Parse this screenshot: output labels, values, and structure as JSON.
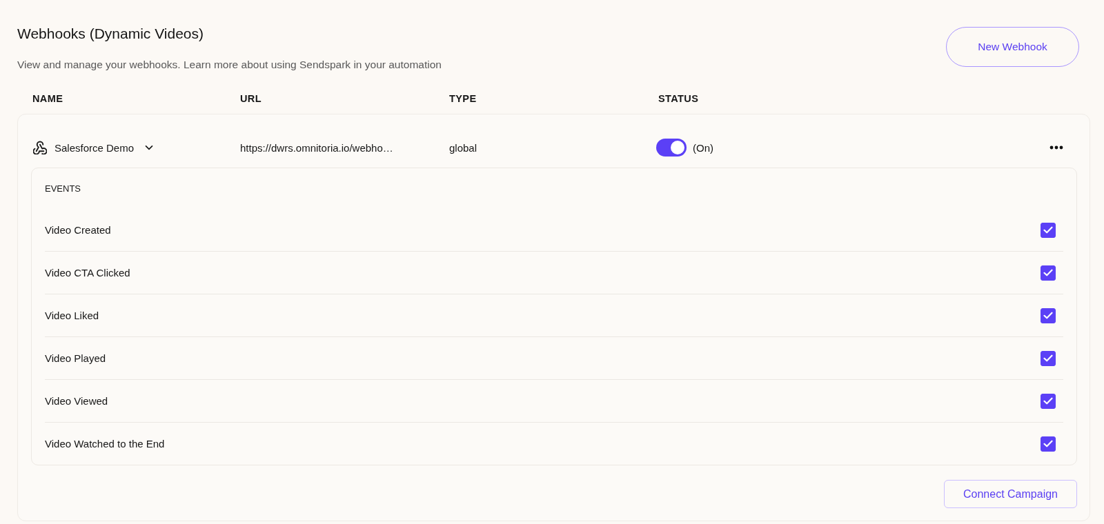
{
  "header": {
    "title": "Webhooks (Dynamic Videos)",
    "subtitle": "View and manage your webhooks. Learn more about using Sendspark in your automation",
    "new_button": "New Webhook"
  },
  "table": {
    "columns": [
      "NAME",
      "URL",
      "TYPE",
      "STATUS"
    ],
    "rows": [
      {
        "name": "Salesforce Demo",
        "expanded": true,
        "url": "https://dwrs.omnitoria.io/webho…",
        "type": "global",
        "on": true,
        "status_label": "(On)",
        "events_heading": "EVENTS",
        "events": [
          {
            "label": "Video Created",
            "checked": true
          },
          {
            "label": "Video CTA Clicked",
            "checked": true
          },
          {
            "label": "Video Liked",
            "checked": true
          },
          {
            "label": "Video Played",
            "checked": true
          },
          {
            "label": "Video Viewed",
            "checked": true
          },
          {
            "label": "Video Watched to the End",
            "checked": true
          }
        ],
        "action_button": "Connect Campaign"
      }
    ]
  }
}
